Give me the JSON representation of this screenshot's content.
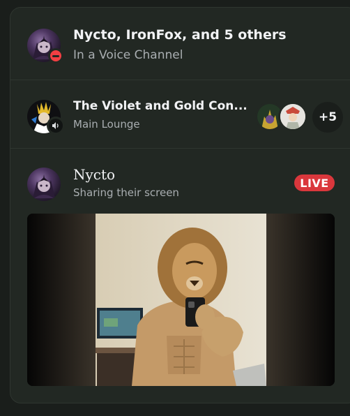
{
  "group_dm": {
    "title": "Nycto, IronFox, and 5 others",
    "subtitle": "In a Voice Channel",
    "status": "do-not-disturb"
  },
  "voice_server": {
    "title": "The Violet and Gold Con...",
    "subtitle": "Main Lounge",
    "badge_icon": "speaker-icon",
    "extra_count": "+5"
  },
  "stream": {
    "user": "Nycto",
    "subtitle": "Sharing their screen",
    "live_label": "LIVE"
  },
  "colors": {
    "card_bg": "#222823",
    "page_bg": "#1a1e1b",
    "live_red": "#da373c",
    "dnd_red": "#f23f43"
  }
}
